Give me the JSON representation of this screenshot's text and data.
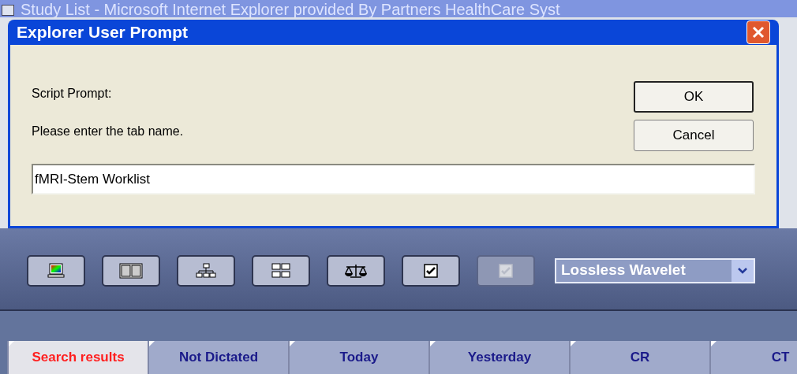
{
  "background_window": {
    "title": "Study List - Microsoft Internet Explorer provided By Partners HealthCare Syst"
  },
  "dialog": {
    "title": "Explorer User Prompt",
    "label": "Script Prompt:",
    "message": "Please enter the tab name.",
    "value": "fMRI-Stem Worklist",
    "buttons": [
      {
        "label": "OK",
        "default": true
      },
      {
        "label": "Cancel",
        "default": false
      }
    ]
  },
  "toolbar": {
    "buttons": [
      {
        "kind": "monitor",
        "disabled": false
      },
      {
        "kind": "columns",
        "disabled": false
      },
      {
        "kind": "tree",
        "disabled": false
      },
      {
        "kind": "grid",
        "disabled": false
      },
      {
        "kind": "scale",
        "disabled": false
      },
      {
        "kind": "check",
        "disabled": false
      },
      {
        "kind": "check",
        "disabled": true
      }
    ],
    "compression": {
      "value": "Lossless Wavelet"
    }
  },
  "tabs": [
    {
      "label": "Search results",
      "selected": true
    },
    {
      "label": "Not Dictated",
      "selected": false
    },
    {
      "label": "Today",
      "selected": false
    },
    {
      "label": "Yesterday",
      "selected": false
    },
    {
      "label": "CR",
      "selected": false
    },
    {
      "label": "CT",
      "selected": false
    }
  ]
}
